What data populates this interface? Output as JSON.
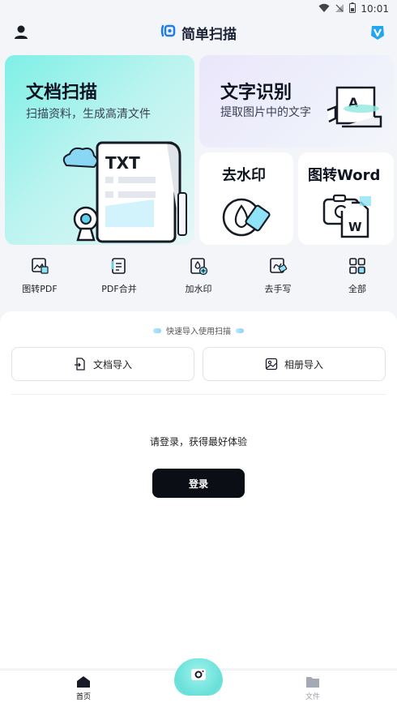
{
  "status_bar": {
    "time": "10:01"
  },
  "header": {
    "title": "简单扫描"
  },
  "cards": {
    "scan": {
      "title": "文档扫描",
      "subtitle": "扫描资料，生成高清文件",
      "illustration_text": "TXT"
    },
    "ocr": {
      "title": "文字识别",
      "subtitle": "提取图片中的文字",
      "illustration_text": "A"
    },
    "watermark": {
      "title": "去水印"
    },
    "word": {
      "title": "图转Word",
      "illustration_text": "W"
    }
  },
  "quick_tools": [
    {
      "label": "图转PDF",
      "icon": "image-pdf-icon"
    },
    {
      "label": "PDF合并",
      "icon": "pdf-merge-icon"
    },
    {
      "label": "加水印",
      "icon": "add-watermark-icon"
    },
    {
      "label": "去手写",
      "icon": "remove-handwriting-icon"
    },
    {
      "label": "全部",
      "icon": "grid-icon"
    }
  ],
  "import": {
    "hint": "快速导入使用扫描",
    "doc_label": "文档导入",
    "album_label": "相册导入"
  },
  "login": {
    "tip": "请登录，获得最好体验",
    "button_label": "登录"
  },
  "bottom_nav": {
    "home_label": "首页",
    "files_label": "文件"
  },
  "colors": {
    "accent": "#67e0d8",
    "primary_dark": "#0b0e14",
    "brand_blue": "#1d7cf2"
  }
}
